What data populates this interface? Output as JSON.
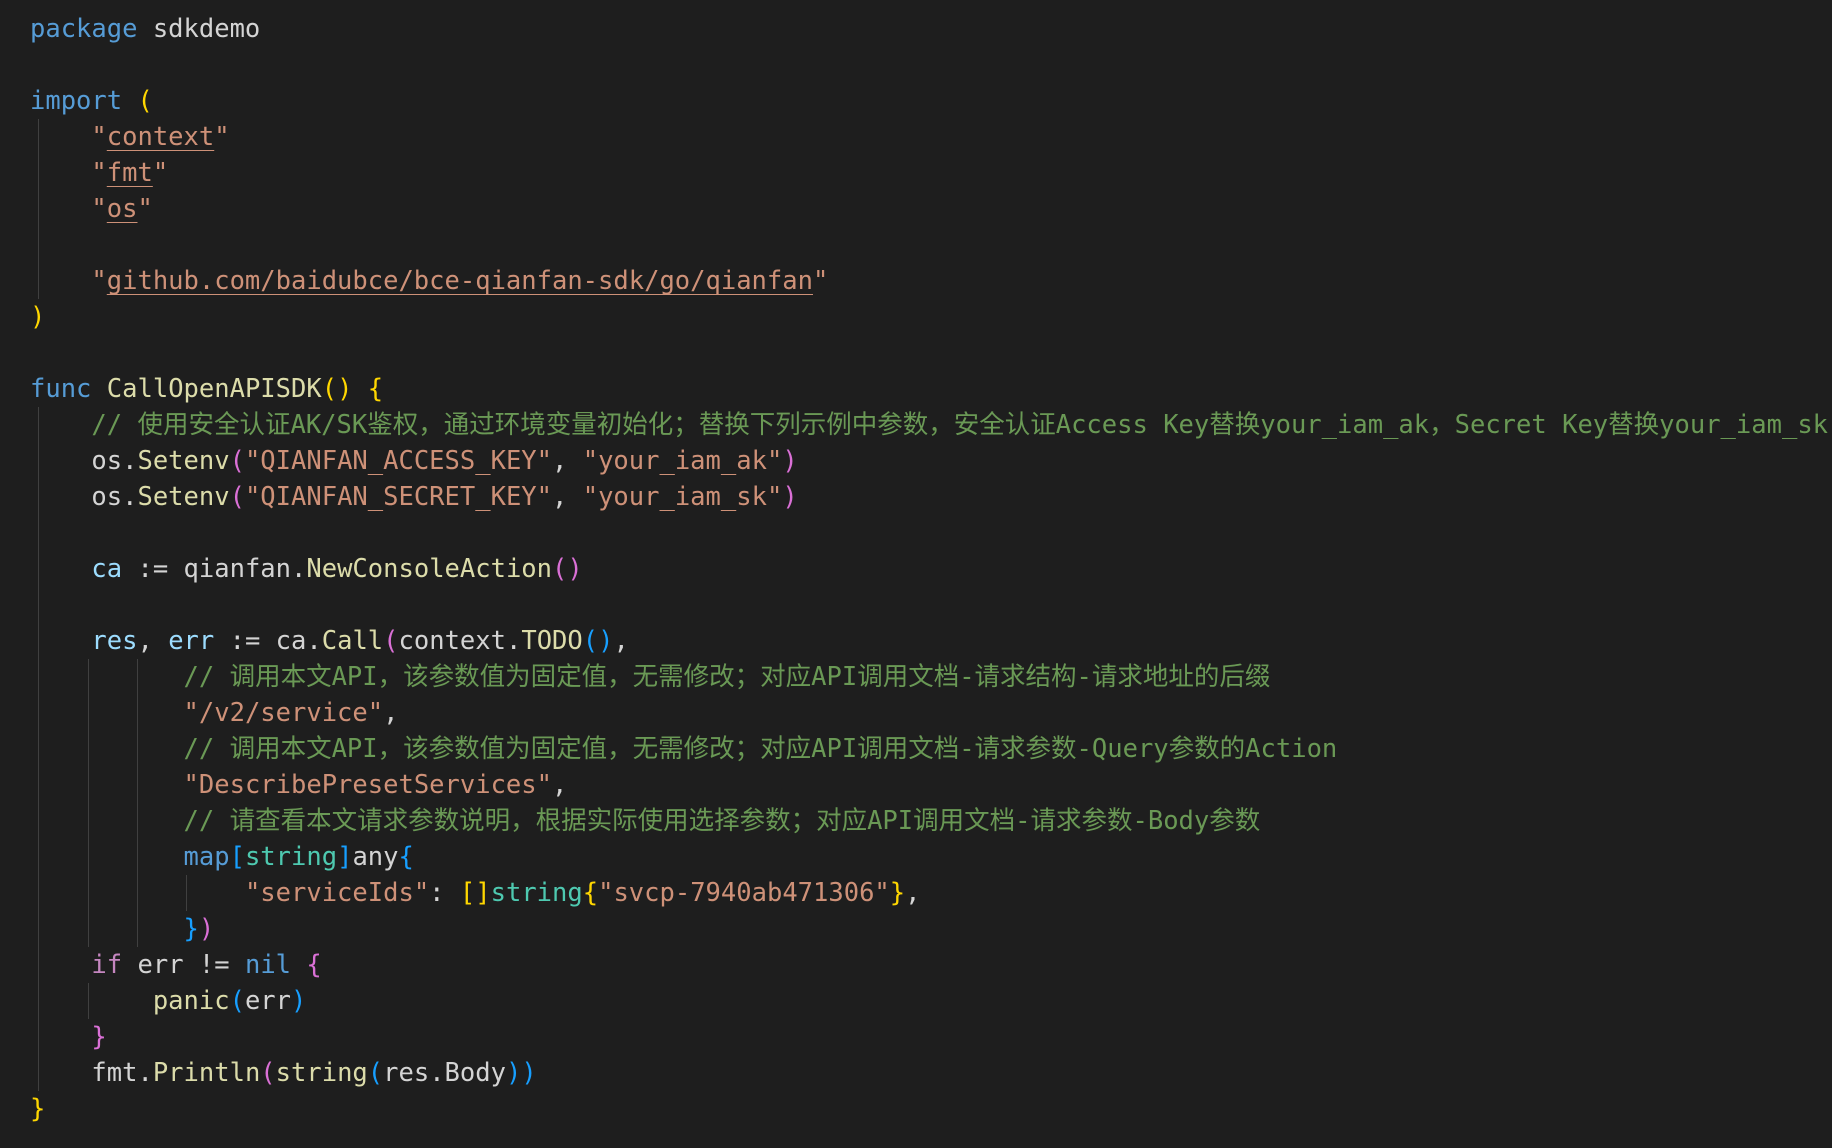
{
  "editor": {
    "language": "go",
    "theme_colors": {
      "background": "#1e1e1e",
      "keyword": "#569cd6",
      "control": "#c586c0",
      "string": "#ce9178",
      "comment": "#6a9955",
      "function": "#dcdcaa",
      "variable": "#9cdcfe",
      "type": "#4ec9b0",
      "bracket_1": "#ffd700",
      "bracket_2": "#da70d6",
      "bracket_3": "#179fff"
    },
    "lines": [
      {
        "guides": [],
        "tokens": [
          [
            "package",
            "kw"
          ],
          [
            " sdkdemo",
            "plain"
          ]
        ]
      },
      {
        "guides": [],
        "tokens": []
      },
      {
        "guides": [],
        "tokens": [
          [
            "import",
            "kw"
          ],
          [
            " ",
            "plain"
          ],
          [
            "(",
            "p1"
          ]
        ]
      },
      {
        "guides": [
          1
        ],
        "tokens": [
          [
            "    \"",
            "str"
          ],
          [
            "context",
            "str u"
          ],
          [
            "\"",
            "str"
          ]
        ]
      },
      {
        "guides": [
          1
        ],
        "tokens": [
          [
            "    \"",
            "str"
          ],
          [
            "fmt",
            "str u"
          ],
          [
            "\"",
            "str"
          ]
        ]
      },
      {
        "guides": [
          1
        ],
        "tokens": [
          [
            "    \"",
            "str"
          ],
          [
            "os",
            "str u"
          ],
          [
            "\"",
            "str"
          ]
        ]
      },
      {
        "guides": [
          1
        ],
        "tokens": []
      },
      {
        "guides": [
          1
        ],
        "tokens": [
          [
            "    \"",
            "str"
          ],
          [
            "github.com/baidubce/bce-qianfan-sdk/go/qianfan",
            "str u"
          ],
          [
            "\"",
            "str"
          ]
        ]
      },
      {
        "guides": [],
        "tokens": [
          [
            ")",
            "p1"
          ]
        ]
      },
      {
        "guides": [],
        "tokens": []
      },
      {
        "guides": [],
        "tokens": [
          [
            "func",
            "kw"
          ],
          [
            " ",
            "plain"
          ],
          [
            "CallOpenAPISDK",
            "fn"
          ],
          [
            "()",
            "p1"
          ],
          [
            " ",
            "plain"
          ],
          [
            "{",
            "p1"
          ]
        ]
      },
      {
        "guides": [
          1
        ],
        "tokens": [
          [
            "    // 使用安全认证AK/SK鉴权，通过环境变量初始化；替换下列示例中参数，安全认证Access Key替换your_iam_ak，Secret Key替换your_iam_sk",
            "cmt"
          ]
        ]
      },
      {
        "guides": [
          1
        ],
        "tokens": [
          [
            "    os.",
            "plain"
          ],
          [
            "Setenv",
            "fn"
          ],
          [
            "(",
            "p2"
          ],
          [
            "\"QIANFAN_ACCESS_KEY\"",
            "str"
          ],
          [
            ", ",
            "plain"
          ],
          [
            "\"your_iam_ak\"",
            "str"
          ],
          [
            ")",
            "p2"
          ]
        ]
      },
      {
        "guides": [
          1
        ],
        "tokens": [
          [
            "    os.",
            "plain"
          ],
          [
            "Setenv",
            "fn"
          ],
          [
            "(",
            "p2"
          ],
          [
            "\"QIANFAN_SECRET_KEY\"",
            "str"
          ],
          [
            ", ",
            "plain"
          ],
          [
            "\"your_iam_sk\"",
            "str"
          ],
          [
            ")",
            "p2"
          ]
        ]
      },
      {
        "guides": [
          1
        ],
        "tokens": []
      },
      {
        "guides": [
          1
        ],
        "tokens": [
          [
            "    ",
            "plain"
          ],
          [
            "ca",
            "var"
          ],
          [
            " := qianfan.",
            "plain"
          ],
          [
            "NewConsoleAction",
            "fn"
          ],
          [
            "()",
            "p2"
          ]
        ]
      },
      {
        "guides": [
          1
        ],
        "tokens": []
      },
      {
        "guides": [
          1
        ],
        "tokens": [
          [
            "    ",
            "plain"
          ],
          [
            "res",
            "var"
          ],
          [
            ", ",
            "plain"
          ],
          [
            "err",
            "var"
          ],
          [
            " := ca.",
            "plain"
          ],
          [
            "Call",
            "fn"
          ],
          [
            "(",
            "p2"
          ],
          [
            "context.",
            "plain"
          ],
          [
            "TODO",
            "fn"
          ],
          [
            "()",
            "p3"
          ],
          [
            ",",
            "plain"
          ]
        ]
      },
      {
        "guides": [
          1,
          5,
          9
        ],
        "tokens": [
          [
            "          // 调用本文API，该参数值为固定值，无需修改；对应API调用文档-请求结构-请求地址的后缀",
            "cmt"
          ]
        ]
      },
      {
        "guides": [
          1,
          5,
          9
        ],
        "tokens": [
          [
            "          ",
            "plain"
          ],
          [
            "\"/v2/service\"",
            "str"
          ],
          [
            ",",
            "plain"
          ]
        ]
      },
      {
        "guides": [
          1,
          5,
          9
        ],
        "tokens": [
          [
            "          // 调用本文API，该参数值为固定值，无需修改；对应API调用文档-请求参数-Query参数的Action",
            "cmt"
          ]
        ]
      },
      {
        "guides": [
          1,
          5,
          9
        ],
        "tokens": [
          [
            "          ",
            "plain"
          ],
          [
            "\"DescribePresetServices\"",
            "str"
          ],
          [
            ",",
            "plain"
          ]
        ]
      },
      {
        "guides": [
          1,
          5,
          9
        ],
        "tokens": [
          [
            "          // 请查看本文请求参数说明，根据实际使用选择参数；对应API调用文档-请求参数-Body参数",
            "cmt"
          ]
        ]
      },
      {
        "guides": [
          1,
          5,
          9
        ],
        "tokens": [
          [
            "          ",
            "plain"
          ],
          [
            "map",
            "kw"
          ],
          [
            "[",
            "p3"
          ],
          [
            "string",
            "type"
          ],
          [
            "]",
            "p3"
          ],
          [
            "any",
            "plain"
          ],
          [
            "{",
            "p3"
          ]
        ]
      },
      {
        "guides": [
          1,
          5,
          9,
          13
        ],
        "tokens": [
          [
            "              ",
            "plain"
          ],
          [
            "\"serviceIds\"",
            "str"
          ],
          [
            ": ",
            "plain"
          ],
          [
            "[]",
            "p1"
          ],
          [
            "string",
            "type"
          ],
          [
            "{",
            "p1"
          ],
          [
            "\"svcp-7940ab471306\"",
            "str"
          ],
          [
            "}",
            "p1"
          ],
          [
            ",",
            "plain"
          ]
        ]
      },
      {
        "guides": [
          1,
          5,
          9
        ],
        "tokens": [
          [
            "          ",
            "plain"
          ],
          [
            "}",
            "p3"
          ],
          [
            ")",
            "p2"
          ]
        ]
      },
      {
        "guides": [
          1
        ],
        "tokens": [
          [
            "    ",
            "plain"
          ],
          [
            "if",
            "ctl"
          ],
          [
            " err != ",
            "plain"
          ],
          [
            "nil",
            "kw"
          ],
          [
            " ",
            "plain"
          ],
          [
            "{",
            "p2"
          ]
        ]
      },
      {
        "guides": [
          1,
          5
        ],
        "tokens": [
          [
            "        ",
            "plain"
          ],
          [
            "panic",
            "fn"
          ],
          [
            "(",
            "p3"
          ],
          [
            "err",
            "plain"
          ],
          [
            ")",
            "p3"
          ]
        ]
      },
      {
        "guides": [
          1
        ],
        "tokens": [
          [
            "    ",
            "plain"
          ],
          [
            "}",
            "p2"
          ]
        ]
      },
      {
        "guides": [
          1
        ],
        "tokens": [
          [
            "    fmt.",
            "plain"
          ],
          [
            "Println",
            "fn"
          ],
          [
            "(",
            "p2"
          ],
          [
            "string",
            "fn"
          ],
          [
            "(",
            "p3"
          ],
          [
            "res.Body",
            "plain"
          ],
          [
            "))",
            "p3"
          ]
        ]
      },
      {
        "guides": [],
        "tokens": [
          [
            "}",
            "p1"
          ]
        ]
      }
    ]
  }
}
